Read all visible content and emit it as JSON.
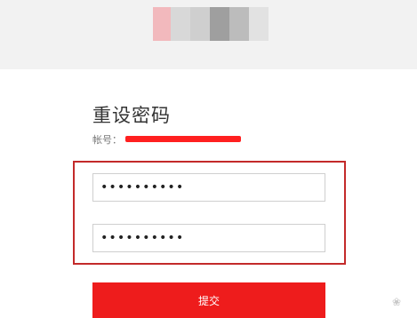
{
  "header": {
    "logo_colors": [
      "#f2b9bd",
      "#d8d8d8",
      "#cfcfcf",
      "#9f9f9f",
      "#bcbcbc",
      "#e2e2e2"
    ]
  },
  "form": {
    "title": "重设密码",
    "account_label": "帐号：",
    "account_value": "",
    "password_1_value": "••••••••••",
    "password_2_value": "••••••••••",
    "submit_label": "提交"
  },
  "colors": {
    "accent": "#ee1c1c",
    "highlight": "#c32a2a",
    "redaction": "#ff2020"
  },
  "watermark": "❀"
}
